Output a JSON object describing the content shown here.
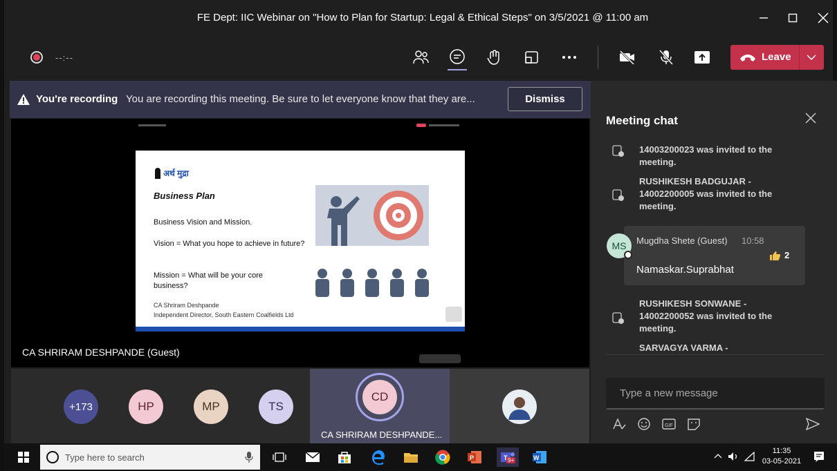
{
  "window": {
    "title": "FE Dept: IIC Webinar on \"How to Plan for Startup: Legal & Ethical Steps\" on 3/5/2021 @ 11:00 am"
  },
  "toolbar": {
    "timer": "--:--",
    "leave_label": "Leave",
    "icons": [
      "participants-icon",
      "chat-icon",
      "raise-hand-icon",
      "breakout-rooms-icon",
      "more-actions-icon",
      "camera-off-icon",
      "mic-off-icon",
      "share-screen-icon"
    ]
  },
  "banner": {
    "strong": "You're recording",
    "message": "You are recording this meeting. Be sure to let everyone know that they are...",
    "dismiss_label": "Dismiss"
  },
  "stage": {
    "speaker_name": "CA SHRIRAM DESHPANDE (Guest)",
    "slide": {
      "logo_text": "अर्थ मुद्रा",
      "title": "Business Plan",
      "line1": "Business Vision and Mission.",
      "line2": "Vision = What you hope to achieve in future?",
      "line3": "Mission = What will be your core business?",
      "author": "CA Shriram Deshpande",
      "author_role": "Independent Director, South Eastern Coalfields Ltd"
    }
  },
  "participants": {
    "more": "+173",
    "avatars": [
      {
        "initials": "HP",
        "bg": "#f3c9d3",
        "fg": "#5a2532"
      },
      {
        "initials": "MP",
        "bg": "#e9d4c4",
        "fg": "#4a3325"
      },
      {
        "initials": "TS",
        "bg": "#d5d0ee",
        "fg": "#34305a"
      }
    ],
    "active": {
      "initials": "CD",
      "label": "CA SHRIRAM DESHPANDE..."
    }
  },
  "chat": {
    "title": "Meeting chat",
    "system_messages": [
      "14003200023 was invited to the meeting.",
      "RUSHIKESH BADGUJAR - 14002200005 was invited to the meeting.",
      "RUSHIKESH SONWANE - 14002200052 was invited to the meeting.",
      "SARVAGYA VARMA -"
    ],
    "message": {
      "avatar": "MS",
      "author": "Mugdha Shete (Guest)",
      "time": "10:58",
      "text": "Namaskar.Suprabhat",
      "reaction_count": "2"
    },
    "compose_placeholder": "Type a new message"
  },
  "taskbar": {
    "search_placeholder": "Type here to search",
    "time": "11:35",
    "date": "03-05-2021",
    "teams_badge": "9+"
  },
  "colors": {
    "leave": "#c4314b",
    "banner": "#33344a",
    "accent": "#6264a7"
  }
}
